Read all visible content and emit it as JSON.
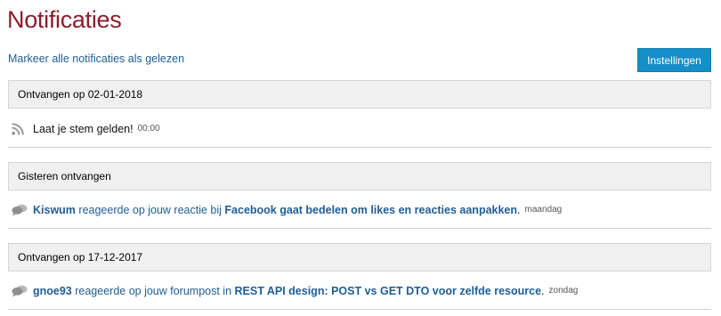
{
  "page": {
    "title": "Notificaties",
    "mark_all_read": "Markeer alle notificaties als gelezen",
    "settings_label": "Instellingen"
  },
  "groups": [
    {
      "header": "Ontvangen op 02-01-2018",
      "item": {
        "icon": "rss-icon",
        "message": "Laat je stem gelden!",
        "time": "00:00"
      }
    },
    {
      "header": "Gisteren ontvangen",
      "item": {
        "icon": "comments-icon",
        "user": "Kiswum",
        "action": " reageerde op jouw reactie bij ",
        "subject": "Facebook gaat bedelen om likes en reacties aanpakken",
        "end": ".",
        "time": "maandag"
      }
    },
    {
      "header": "Ontvangen op 17-12-2017",
      "item": {
        "icon": "comments-icon",
        "user": "gnoe93",
        "action": " reageerde op jouw forumpost in ",
        "subject": "REST API design: POST vs GET DTO voor zelfde resource",
        "end": ".",
        "time": "zondag"
      }
    }
  ]
}
